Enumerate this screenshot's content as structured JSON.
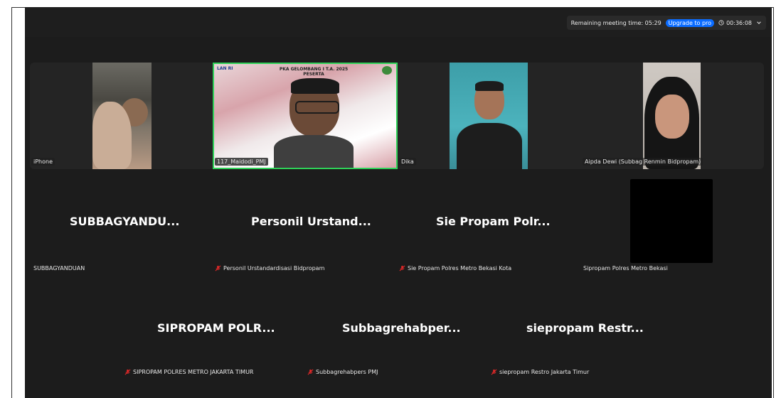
{
  "topbar": {
    "remaining_label": "Remaining meeting time: 05:29",
    "upgrade_label": "Upgrade to pro",
    "elapsed": "00:36:08"
  },
  "video_tiles": [
    {
      "name": "iPhone"
    },
    {
      "name": "117_Maidodi_PMJ",
      "banner_title": "PKA GELOMBANG I T.A. 2025",
      "banner_sub": "PESERTA",
      "logo_text": "LAN RI"
    },
    {
      "name": "Dika"
    },
    {
      "name": "Aipda Dewi (Subbag Renmin Bidpropam)"
    }
  ],
  "row2": [
    {
      "big": "SUBBAGYANDU...",
      "label": "SUBBAGYANDUAN",
      "muted": false
    },
    {
      "big": "Personil Urstand...",
      "label": "Personil Urstandardisasi Bidpropam",
      "muted": true
    },
    {
      "big": "Sie Propam Polr...",
      "label": "Sie Propam Polres Metro Bekasi Kota",
      "muted": true
    },
    {
      "big": "",
      "label": "Sipropam Polres Metro Bekasi",
      "muted": false
    }
  ],
  "row3": [
    {
      "big": "SIPROPAM POLR...",
      "label": "SIPROPAM POLRES METRO JAKARTA TIMUR",
      "muted": true
    },
    {
      "big": "Subbagrehabper...",
      "label": "Subbagrehabpers PMJ",
      "muted": true
    },
    {
      "big": "siepropam Restr...",
      "label": "siepropam Restro Jakarta Timur",
      "muted": true
    }
  ],
  "colors": {
    "accent_green": "#2fd158",
    "upgrade_blue": "#0b6cff",
    "mute_red": "#e02828"
  },
  "icons": [
    "clock-icon",
    "chevron-down-icon",
    "mic-muted-icon"
  ]
}
